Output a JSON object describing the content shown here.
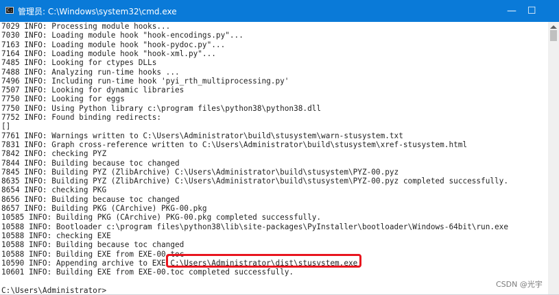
{
  "window": {
    "title": "管理员: C:\\Windows\\system32\\cmd.exe",
    "minimize_glyph": "—",
    "maximize_glyph": "☐",
    "icon": "cmd-icon"
  },
  "console": {
    "lines": [
      "7029 INFO: Processing module hooks...",
      "7030 INFO: Loading module hook \"hook-encodings.py\"...",
      "7163 INFO: Loading module hook \"hook-pydoc.py\"...",
      "7164 INFO: Loading module hook \"hook-xml.py\"...",
      "7485 INFO: Looking for ctypes DLLs",
      "7488 INFO: Analyzing run-time hooks ...",
      "7496 INFO: Including run-time hook 'pyi_rth_multiprocessing.py'",
      "7507 INFO: Looking for dynamic libraries",
      "7750 INFO: Looking for eggs",
      "7750 INFO: Using Python library c:\\program files\\python38\\python38.dll",
      "7752 INFO: Found binding redirects:",
      "[]",
      "7761 INFO: Warnings written to C:\\Users\\Administrator\\build\\stusystem\\warn-stusystem.txt",
      "7831 INFO: Graph cross-reference written to C:\\Users\\Administrator\\build\\stusystem\\xref-stusystem.html",
      "7842 INFO: checking PYZ",
      "7844 INFO: Building because toc changed",
      "7845 INFO: Building PYZ (ZlibArchive) C:\\Users\\Administrator\\build\\stusystem\\PYZ-00.pyz",
      "8635 INFO: Building PYZ (ZlibArchive) C:\\Users\\Administrator\\build\\stusystem\\PYZ-00.pyz completed successfully.",
      "8654 INFO: checking PKG",
      "8656 INFO: Building because toc changed",
      "8657 INFO: Building PKG (CArchive) PKG-00.pkg",
      "10585 INFO: Building PKG (CArchive) PKG-00.pkg completed successfully.",
      "10588 INFO: Bootloader c:\\program files\\python38\\lib\\site-packages\\PyInstaller\\bootloader\\Windows-64bit\\run.exe",
      "10588 INFO: checking EXE",
      "10588 INFO: Building because toc changed",
      "10588 INFO: Building EXE from EXE-00.toc",
      "10590 INFO: Appending archive to EXE C:\\Users\\Administrator\\dist\\stusystem.exe",
      "10601 INFO: Building EXE from EXE-00.toc completed successfully.",
      "",
      "C:\\Users\\Administrator>"
    ]
  },
  "highlight": {
    "text": "C:\\Users\\Administrator\\dist\\stusystem.exe",
    "color": "#e8141e"
  },
  "watermark": "CSDN @光宇",
  "colors": {
    "titlebar": "#0a7ad8",
    "console_bg": "#ffffff",
    "console_text": "#222222"
  }
}
